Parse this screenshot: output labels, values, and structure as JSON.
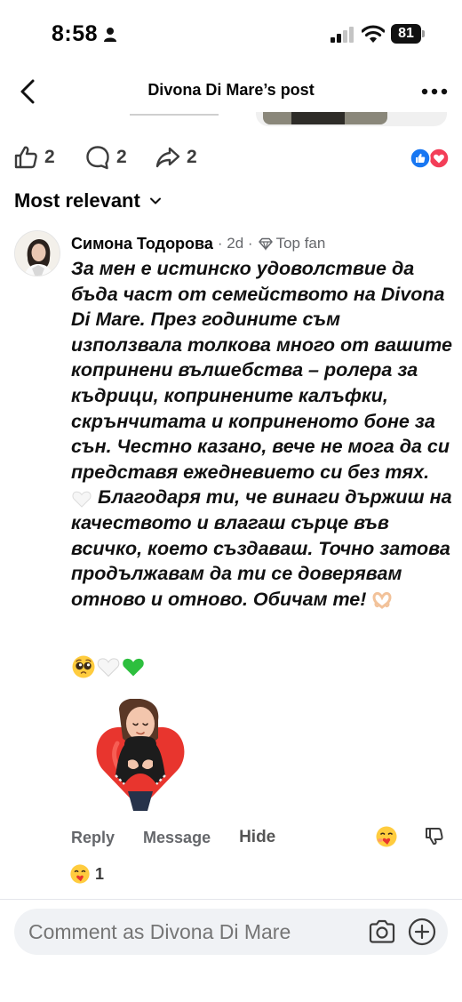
{
  "status_bar": {
    "time": "8:58",
    "battery": "81"
  },
  "header": {
    "title": "Divona Di Mare’s post"
  },
  "stats": {
    "likes": "2",
    "comments": "2",
    "shares": "2"
  },
  "sort": {
    "label": "Most relevant"
  },
  "comment": {
    "author": "Симона Тодорова",
    "time": "· 2d ·",
    "badge": "Top fan",
    "text_part1": "За мен е истинско удоволствие да бъда част от семейството на Divona Di Mare. През годините съм използвала толкова много от вашите копринени вълшебства – ролера за къдрици, копринените калъфки, скрънчитата и копринeното боне за сън. Честно казано, вече не мога да си представя ежедневието си без тях.",
    "text_part2": "Благодаря ти, че винаги държиш на качеството и влагаш сърце във всичко, което създаваш. Точно затова продължавам да ти се доверявам отново и отново. Обичам те!",
    "actions": {
      "reply": "Reply",
      "message": "Message",
      "hide": "Hide"
    },
    "reaction_count": "1"
  },
  "composer": {
    "placeholder": "Comment as Divona Di Mare"
  },
  "colors": {
    "like_blue": "#1877f2",
    "love_red": "#f33e58",
    "muted_text": "#65676b",
    "composer_bg": "#f0f2f5"
  }
}
